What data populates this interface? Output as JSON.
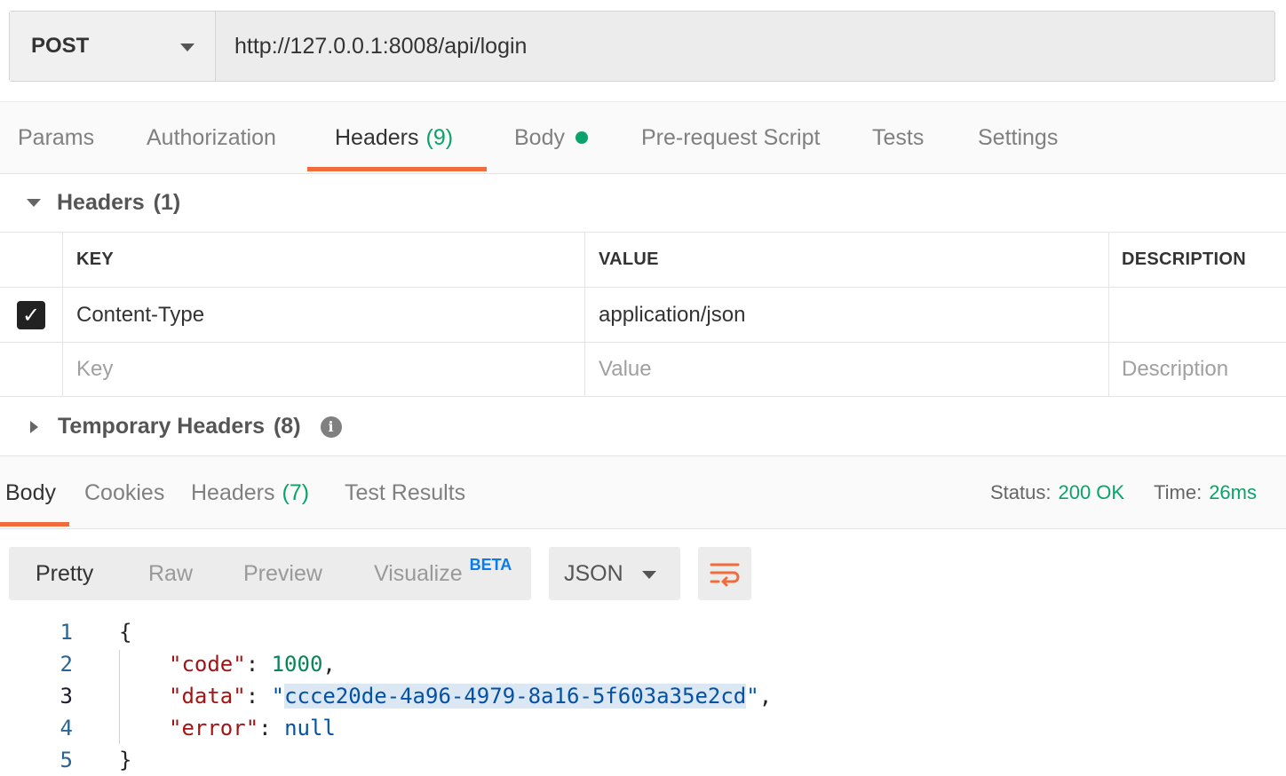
{
  "request": {
    "method": "POST",
    "url": "http://127.0.0.1:8008/api/login"
  },
  "request_tabs": [
    {
      "label": "Params"
    },
    {
      "label": "Authorization"
    },
    {
      "label": "Headers",
      "count": "(9)"
    },
    {
      "label": "Body"
    },
    {
      "label": "Pre-request Script"
    },
    {
      "label": "Tests"
    },
    {
      "label": "Settings"
    }
  ],
  "headers_section": {
    "title": "Headers",
    "count": "(1)",
    "columns": {
      "key": "KEY",
      "value": "VALUE",
      "description": "DESCRIPTION"
    },
    "rows": [
      {
        "checked": true,
        "key": "Content-Type",
        "value": "application/json",
        "description": ""
      }
    ],
    "placeholders": {
      "key": "Key",
      "value": "Value",
      "description": "Description"
    }
  },
  "temporary_headers": {
    "title": "Temporary Headers",
    "count": "(8)"
  },
  "response_tabs": [
    {
      "label": "Body"
    },
    {
      "label": "Cookies"
    },
    {
      "label": "Headers",
      "count": "(7)"
    },
    {
      "label": "Test Results"
    }
  ],
  "status": {
    "status_label": "Status:",
    "status_value": "200 OK",
    "time_label": "Time:",
    "time_value": "26ms"
  },
  "view_modes": {
    "pretty": "Pretty",
    "raw": "Raw",
    "preview": "Preview",
    "visualize": "Visualize",
    "beta": "BETA"
  },
  "format": "JSON",
  "code": {
    "line_numbers": [
      "1",
      "2",
      "3",
      "4",
      "5"
    ],
    "open_brace": "{",
    "close_brace": "}",
    "code_key": "\"code\"",
    "code_value": "1000",
    "data_key": "\"data\"",
    "data_value": "ccce20de-4a96-4979-8a16-5f603a35e2cd",
    "error_key": "\"error\"",
    "error_value": "null"
  },
  "colors": {
    "accent": "#f26b3a",
    "success": "#09a36b",
    "beta": "#097bed"
  }
}
